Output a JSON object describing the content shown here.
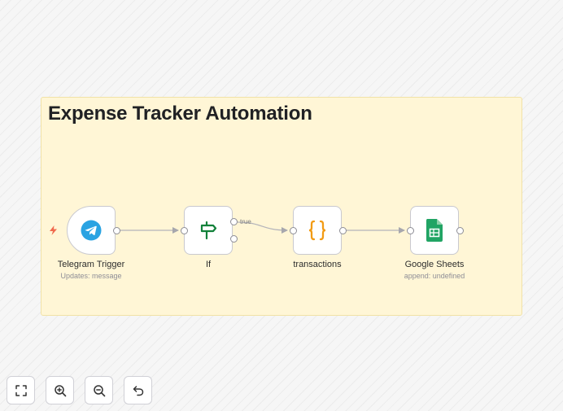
{
  "canvas": {
    "sticky_note": {
      "title": "Expense Tracker Automation"
    },
    "nodes": [
      {
        "name": "Telegram Trigger",
        "subtitle": "Updates: message",
        "icon": "telegram-icon",
        "color": "#2aa3e2"
      },
      {
        "name": "If",
        "subtitle": "",
        "icon": "signpost-icon",
        "color": "#12813a"
      },
      {
        "name": "transactions",
        "subtitle": "",
        "icon": "code-braces-icon",
        "color": "#f29b14"
      },
      {
        "name": "Google Sheets",
        "subtitle": "append: undefined",
        "icon": "google-sheets-icon",
        "color": "#21a464"
      }
    ],
    "connections": [
      {
        "from": "Telegram Trigger",
        "to": "If",
        "label": ""
      },
      {
        "from": "If",
        "to": "transactions",
        "label": "true"
      },
      {
        "from": "transactions",
        "to": "Google Sheets",
        "label": ""
      }
    ],
    "trigger_indicator": {
      "icon": "lightning-bolt-icon",
      "color": "#f06a4e"
    }
  },
  "controls": [
    {
      "name": "fit-view",
      "icon": "fit-view-icon"
    },
    {
      "name": "zoom-in",
      "icon": "zoom-in-icon"
    },
    {
      "name": "zoom-out",
      "icon": "zoom-out-icon"
    },
    {
      "name": "undo",
      "icon": "undo-icon"
    }
  ]
}
